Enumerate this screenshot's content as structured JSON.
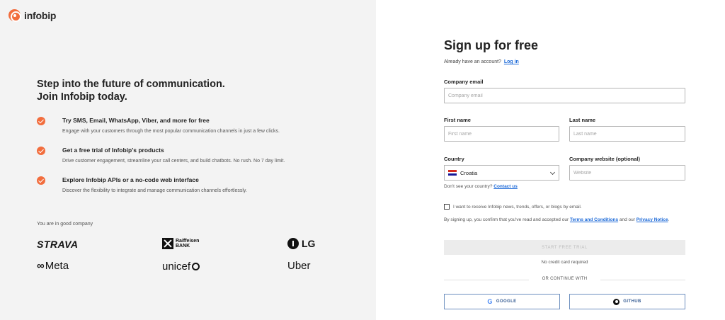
{
  "brand": {
    "name": "infobip",
    "accent": "#f26d3d"
  },
  "hero": {
    "line1": "Step into the future of communication.",
    "line2": "Join Infobip today."
  },
  "features": [
    {
      "title": "Try SMS, Email, WhatsApp, Viber, and more for free",
      "desc": "Engage with your customers through the most popular communication channels in just a few clicks."
    },
    {
      "title": "Get a free trial of Infobip's products",
      "desc": "Drive customer engagement, streamline your call centers, and build chatbots. No rush. No 7 day limit."
    },
    {
      "title": "Explore Infobip APIs or a no-code web interface",
      "desc": "Discover the flexibility to integrate and manage communication channels effortlessly."
    }
  ],
  "company": {
    "label": "You are in good company",
    "logos": {
      "strava": "STRAVA",
      "raiffeisen_line1": "Raiffeisen",
      "raiffeisen_line2": "BANK",
      "lg": "LG",
      "meta": "Meta",
      "meta_icon": "∞",
      "unicef": "unicef",
      "uber": "Uber"
    }
  },
  "form": {
    "title": "Sign up for free",
    "already_text": "Already have an account?",
    "login_link": "Log in",
    "email_label": "Company email",
    "email_placeholder": "Company email",
    "first_name_label": "First name",
    "first_name_placeholder": "First name",
    "last_name_label": "Last name",
    "last_name_placeholder": "Last name",
    "country_label": "Country",
    "country_value": "Croatia",
    "website_label": "Company website (optional)",
    "website_placeholder": "Website",
    "country_missing_text": "Don't see your country?",
    "contact_link": "Contact us",
    "newsletter_label": "I want to receive Infobip news, trends, offers, or blogs by email.",
    "consent_prefix": "By signing up, you confirm that you've read and accepted our",
    "terms_link": "Terms and Conditions",
    "consent_and": "and our",
    "privacy_link": "Privacy Notice",
    "start_button": "START FREE TRIAL",
    "no_card": "No credit card required",
    "or_continue": "OR CONTINUE WITH",
    "google_button": "GOOGLE",
    "github_button": "GITHUB"
  }
}
